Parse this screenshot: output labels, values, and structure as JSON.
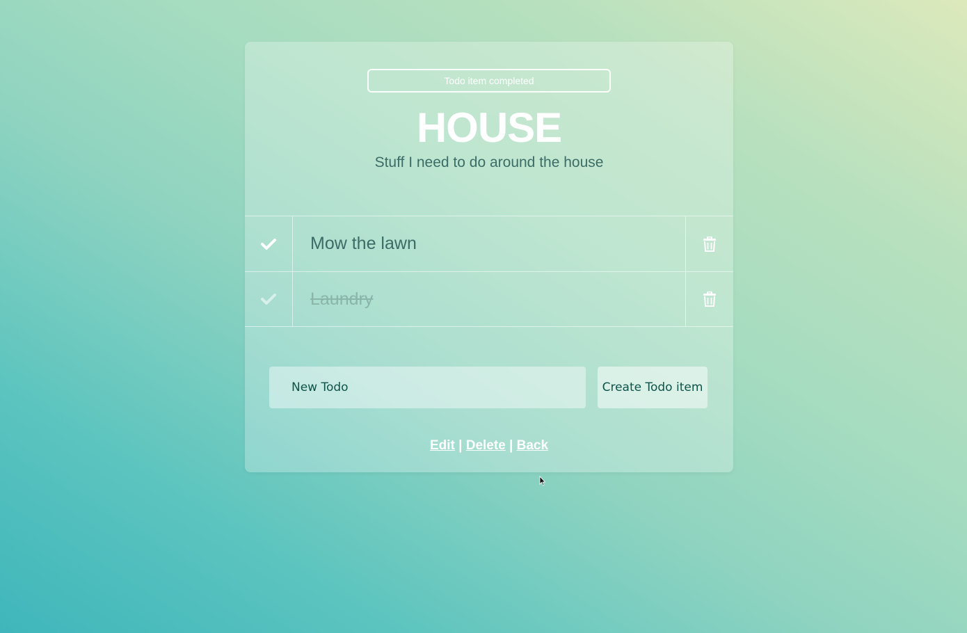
{
  "flash": {
    "message": "Todo item completed"
  },
  "list": {
    "title": "HOUSE",
    "description": "Stuff I need to do around the house"
  },
  "todos": [
    {
      "content": "Mow the lawn",
      "completed": false
    },
    {
      "content": "Laundry",
      "completed": true
    }
  ],
  "form": {
    "placeholder": "New Todo",
    "submit_label": "Create Todo item"
  },
  "footer_links": {
    "edit": "Edit",
    "delete": "Delete",
    "back": "Back",
    "separator": "|"
  },
  "colors": {
    "heading": "#ffffff",
    "body_text": "#3b6c66",
    "completed_text": "#8ab5a9",
    "button_text": "#0d5348"
  },
  "icons": {
    "toggle": "check-icon",
    "remove": "trash-icon"
  }
}
